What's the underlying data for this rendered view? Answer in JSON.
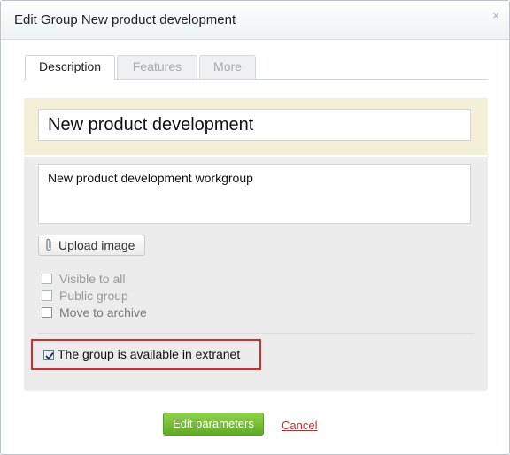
{
  "dialog": {
    "title": "Edit Group New product development",
    "close_glyph": "×"
  },
  "tabs": [
    {
      "label": "Description",
      "active": true
    },
    {
      "label": "Features",
      "active": false
    },
    {
      "label": "More",
      "active": false
    }
  ],
  "form": {
    "group_name": "New product development",
    "description": "New product development workgroup",
    "upload_label": "Upload image",
    "options": [
      {
        "label": "Visible to all",
        "checked": false
      },
      {
        "label": "Public group",
        "checked": false
      },
      {
        "label": "Move to archive",
        "checked": false
      }
    ],
    "extranet": {
      "label": "The group is available in extranet",
      "checked": true
    }
  },
  "footer": {
    "primary_label": "Edit parameters",
    "cancel_label": "Cancel"
  },
  "colors": {
    "highlight_border": "#d62b2b",
    "primary_button": "#6dba2e",
    "name_panel": "#f3f0d7",
    "form_panel": "#ececec"
  }
}
